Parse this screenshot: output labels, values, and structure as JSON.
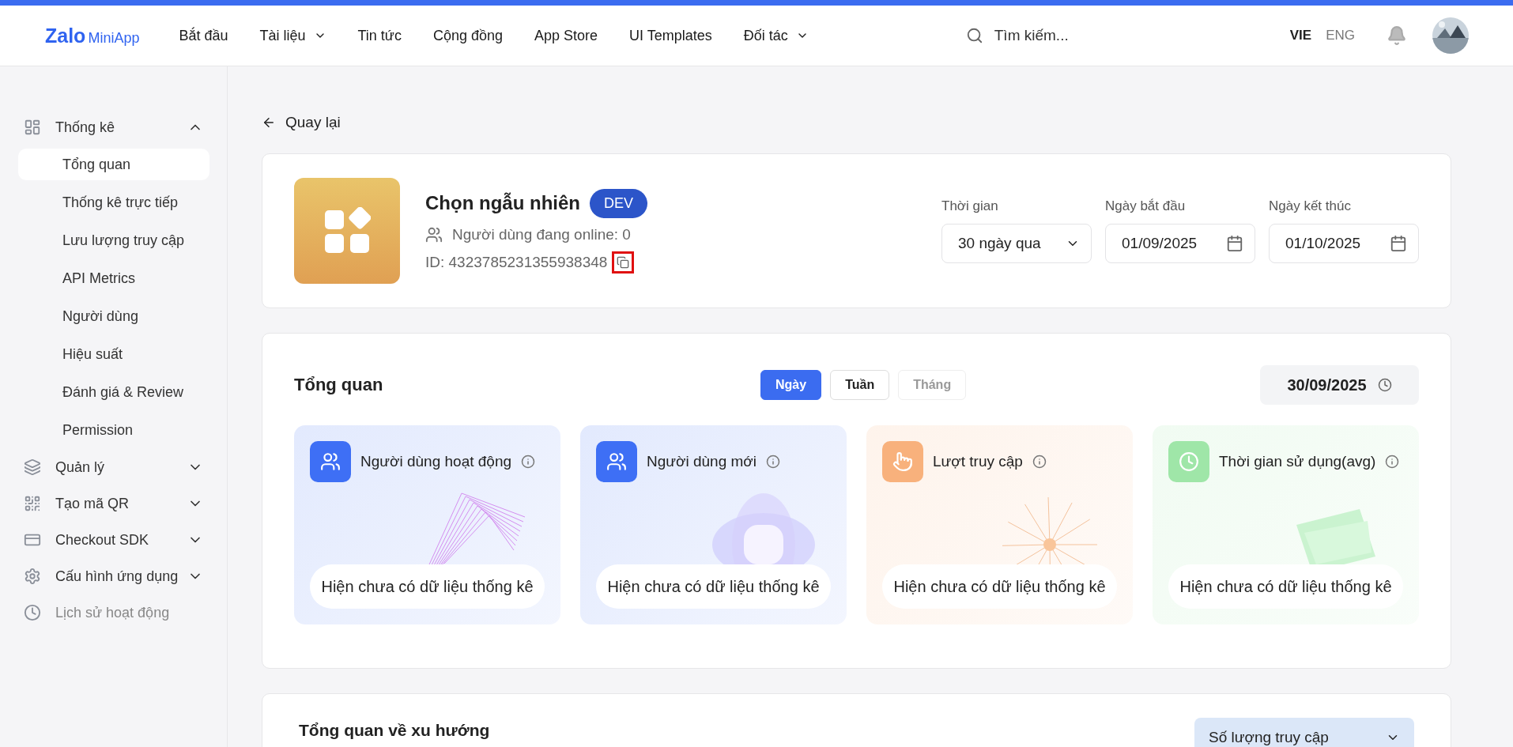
{
  "nav": {
    "logo_main": "Zalo",
    "logo_sub": "MiniApp",
    "items": [
      {
        "label": "Bắt đầu",
        "dropdown": false
      },
      {
        "label": "Tài liệu",
        "dropdown": true
      },
      {
        "label": "Tin tức",
        "dropdown": false
      },
      {
        "label": "Cộng đồng",
        "dropdown": false
      },
      {
        "label": "App Store",
        "dropdown": false
      },
      {
        "label": "UI Templates",
        "dropdown": false
      },
      {
        "label": "Đối tác",
        "dropdown": true
      }
    ],
    "search": {
      "placeholder": "Tìm kiếm..."
    },
    "languages": [
      {
        "label": "VIE",
        "selected": true
      },
      {
        "label": "ENG",
        "selected": false
      }
    ]
  },
  "sidebar": {
    "items": [
      {
        "label": "Thống kê",
        "kind": "dashboard",
        "expanded": true,
        "disabled": false,
        "children": [
          {
            "label": "Tổng quan",
            "selected": true
          },
          {
            "label": "Thống kê trực tiếp",
            "selected": false
          },
          {
            "label": "Lưu lượng truy cập",
            "selected": false
          },
          {
            "label": "API Metrics",
            "selected": false
          },
          {
            "label": "Người dùng",
            "selected": false
          },
          {
            "label": "Hiệu suất",
            "selected": false
          },
          {
            "label": "Đánh giá & Review",
            "selected": false
          },
          {
            "label": "Permission",
            "selected": false
          }
        ]
      },
      {
        "label": "Quản lý",
        "kind": "layers",
        "expanded": false,
        "disabled": false
      },
      {
        "label": "Tạo mã QR",
        "kind": "qr",
        "expanded": false,
        "disabled": false
      },
      {
        "label": "Checkout SDK",
        "kind": "card",
        "expanded": false,
        "disabled": false
      },
      {
        "label": "Cấu hình ứng dụng",
        "kind": "gear",
        "expanded": false,
        "disabled": false
      },
      {
        "label": "Lịch sử hoạt động",
        "kind": "clock",
        "disabled": true
      }
    ]
  },
  "back": "Quay lại",
  "app": {
    "name": "Chọn ngẫu nhiên",
    "badge": "DEV",
    "online": "Người dùng đang online: 0",
    "id": "ID: 4323785231355938348",
    "copy_highlighted": true
  },
  "filters": [
    {
      "label": "Thời gian",
      "value": "30 ngày qua",
      "kind": "select"
    },
    {
      "label": "Ngày bắt đầu",
      "value": "01/09/2025",
      "kind": "date"
    },
    {
      "label": "Ngày kết thúc",
      "value": "01/10/2025",
      "kind": "date"
    }
  ],
  "overview": {
    "title": "Tổng quan",
    "tabs": [
      {
        "label": "Ngày",
        "selected": true,
        "disabled": false
      },
      {
        "label": "Tuần",
        "selected": false,
        "disabled": false
      },
      {
        "label": "Tháng",
        "selected": false,
        "disabled": true
      }
    ],
    "date": "30/09/2025",
    "cards": [
      {
        "title": "Người dùng hoạt động",
        "kind": "users",
        "color": "#3e6ff5",
        "message": "Hiện chưa có dữ liệu thống kê"
      },
      {
        "title": "Người dùng mới",
        "kind": "users",
        "color": "#3e6ff5",
        "message": "Hiện chưa có dữ liệu thống kê"
      },
      {
        "title": "Lượt truy cập",
        "kind": "touch",
        "color": "#f8b17c",
        "message": "Hiện chưa có dữ liệu thống kê"
      },
      {
        "title": "Thời gian sử dụng(avg)",
        "kind": "clock",
        "color": "#9fe6a8",
        "message": "Hiện chưa có dữ liệu thống kê"
      }
    ]
  },
  "trend": {
    "title": "Tổng quan về xu hướng",
    "metric": "Số lượng truy cập"
  }
}
